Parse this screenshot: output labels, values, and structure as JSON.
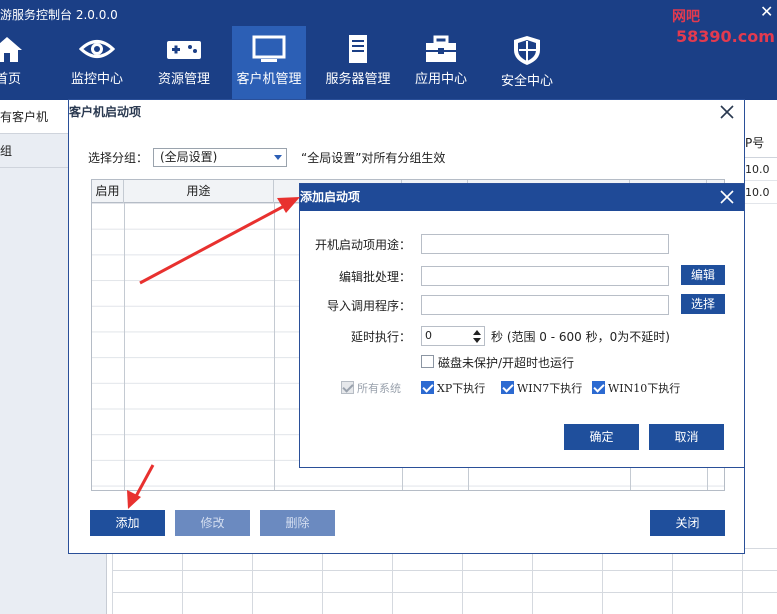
{
  "app": {
    "title": "游服务控制台 2.0.0.0",
    "close_glyph": "✕"
  },
  "watermark": {
    "line1": "网吧",
    "line2": "58390.com"
  },
  "nav": [
    {
      "label": "首页",
      "icon": "home-icon"
    },
    {
      "label": "监控中心",
      "icon": "eye-icon"
    },
    {
      "label": "资源管理",
      "icon": "gamepad-icon"
    },
    {
      "label": "客户机管理",
      "icon": "monitor-icon"
    },
    {
      "label": "服务器管理",
      "icon": "server-icon"
    },
    {
      "label": "应用中心",
      "icon": "toolbox-icon"
    },
    {
      "label": "安全中心",
      "icon": "shield-icon"
    }
  ],
  "left_panel": {
    "items": [
      "有客户机",
      "组"
    ]
  },
  "right_strip": {
    "header": "P号",
    "values": [
      "10.0",
      "10.0"
    ]
  },
  "dialog1": {
    "title": "客户机启动项",
    "group_label": "选择分组：",
    "group_value": "(全局设置)",
    "hint": "“全局设置”对所有分组生效",
    "columns": [
      "启用",
      "用途"
    ],
    "buttons": {
      "add": "添加",
      "edit": "修改",
      "delete": "删除",
      "close": "关闭"
    }
  },
  "dialog2": {
    "title": "添加启动项",
    "purpose_label": "开机启动项用途：",
    "batch_label": "编辑批处理：",
    "batch_button": "编辑",
    "program_label": "导入调用程序：",
    "program_button": "选择",
    "delay_label": "延时执行：",
    "delay_value": "0",
    "delay_unit_hint": "秒 (范围 0 - 600 秒，0为不延时)",
    "disk_option": "磁盘未保护/开超时也运行",
    "os_all": "所有系统",
    "os_xp": "XP下执行",
    "os_win7": "WIN7下执行",
    "os_win10": "WIN10下执行",
    "checks": {
      "disk": false,
      "all": true,
      "xp": true,
      "win7": true,
      "win10": true
    },
    "ok": "确定",
    "cancel": "取消"
  },
  "colors": {
    "nav_bg": "#1b3f86",
    "nav_active": "#2c5fb5",
    "button": "#1f4f9c",
    "arrow": "#e8312f"
  }
}
